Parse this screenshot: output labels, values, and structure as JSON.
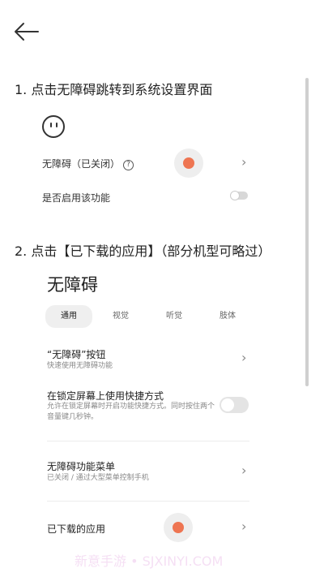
{
  "step1_title": "1. 点击无障碍跳转到系统设置界面",
  "accessibility_row": {
    "label": "无障碍（已关闭）",
    "help_glyph": "?"
  },
  "enable_row": {
    "label": "是否启用该功能"
  },
  "step2_title": "2. 点击【已下载的应用】（部分机型可略过）",
  "settings_page": {
    "title": "无障碍",
    "tabs": [
      "通用",
      "视觉",
      "听觉",
      "肢体"
    ],
    "active_tab": "通用",
    "items": [
      {
        "title": "“无障碍”按钮",
        "subtitle": "快速使用无障碍功能"
      },
      {
        "title": "在锁定屏幕上使用快捷方式",
        "subtitle": "允许在锁定屏幕时开启功能快捷方式。同时按住两个音量键几秒钟。"
      },
      {
        "title": "无障碍功能菜单",
        "subtitle": "已关闭 / 通过大型菜单控制手机"
      },
      {
        "title": "已下载的应用",
        "subtitle": ""
      }
    ]
  },
  "watermark": "新意手游 • SJXINYI.COM",
  "colors": {
    "accent_dot": "#ee7552",
    "toggle_off": "#d8d8d8"
  },
  "icons": {
    "back": "arrow-left-icon",
    "face": "face-icon",
    "chevron": "chevron-right-icon"
  }
}
